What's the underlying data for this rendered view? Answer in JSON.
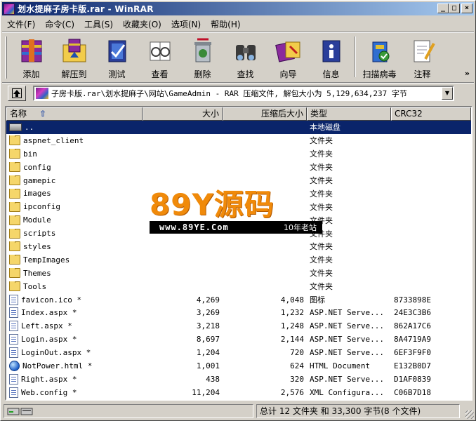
{
  "window": {
    "title": "划水提麻子房卡版.rar - WinRAR",
    "buttons": {
      "minimize": "_",
      "maximize": "□",
      "close": "×"
    }
  },
  "menu": [
    "文件(F)",
    "命令(C)",
    "工具(S)",
    "收藏夹(O)",
    "选项(N)",
    "帮助(H)"
  ],
  "toolbar": {
    "items": [
      {
        "label": "添加",
        "icon": "add-archive-icon"
      },
      {
        "label": "解压到",
        "icon": "extract-to-icon"
      },
      {
        "label": "测试",
        "icon": "test-icon"
      },
      {
        "label": "查看",
        "icon": "view-icon"
      },
      {
        "label": "删除",
        "icon": "delete-icon"
      },
      {
        "label": "查找",
        "icon": "find-icon"
      },
      {
        "label": "向导",
        "icon": "wizard-icon"
      },
      {
        "label": "信息",
        "icon": "info-icon"
      },
      {
        "label": "扫描病毒",
        "icon": "virus-scan-icon"
      },
      {
        "label": "注释",
        "icon": "comment-icon"
      }
    ],
    "more": "»"
  },
  "address": {
    "path": "子房卡版.rar\\划水提麻子\\网站\\GameAdmin - RAR 压缩文件, 解包大小为 5,129,634,237 字节"
  },
  "list": {
    "columns": {
      "name": "名称",
      "size": "大小",
      "packed": "压缩后大小",
      "type": "类型",
      "crc": "CRC32"
    },
    "rows": [
      {
        "name": "..",
        "size": "",
        "packed": "",
        "type": "本地磁盘",
        "crc": "",
        "kind": "drive",
        "selected": true
      },
      {
        "name": "aspnet_client",
        "size": "",
        "packed": "",
        "type": "文件夹",
        "crc": "",
        "kind": "folder"
      },
      {
        "name": "bin",
        "size": "",
        "packed": "",
        "type": "文件夹",
        "crc": "",
        "kind": "folder"
      },
      {
        "name": "config",
        "size": "",
        "packed": "",
        "type": "文件夹",
        "crc": "",
        "kind": "folder"
      },
      {
        "name": "gamepic",
        "size": "",
        "packed": "",
        "type": "文件夹",
        "crc": "",
        "kind": "folder"
      },
      {
        "name": "images",
        "size": "",
        "packed": "",
        "type": "文件夹",
        "crc": "",
        "kind": "folder"
      },
      {
        "name": "ipconfig",
        "size": "",
        "packed": "",
        "type": "文件夹",
        "crc": "",
        "kind": "folder"
      },
      {
        "name": "Module",
        "size": "",
        "packed": "",
        "type": "文件夹",
        "crc": "",
        "kind": "folder"
      },
      {
        "name": "scripts",
        "size": "",
        "packed": "",
        "type": "文件夹",
        "crc": "",
        "kind": "folder"
      },
      {
        "name": "styles",
        "size": "",
        "packed": "",
        "type": "文件夹",
        "crc": "",
        "kind": "folder"
      },
      {
        "name": "TempImages",
        "size": "",
        "packed": "",
        "type": "文件夹",
        "crc": "",
        "kind": "folder"
      },
      {
        "name": "Themes",
        "size": "",
        "packed": "",
        "type": "文件夹",
        "crc": "",
        "kind": "folder"
      },
      {
        "name": "Tools",
        "size": "",
        "packed": "",
        "type": "文件夹",
        "crc": "",
        "kind": "folder"
      },
      {
        "name": "favicon.ico *",
        "size": "4,269",
        "packed": "4,048",
        "type": "图标",
        "crc": "8733898E",
        "kind": "file"
      },
      {
        "name": "Index.aspx *",
        "size": "3,269",
        "packed": "1,232",
        "type": "ASP.NET Serve...",
        "crc": "24E3C3B6",
        "kind": "file"
      },
      {
        "name": "Left.aspx *",
        "size": "3,218",
        "packed": "1,248",
        "type": "ASP.NET Serve...",
        "crc": "862A17C6",
        "kind": "file"
      },
      {
        "name": "Login.aspx *",
        "size": "8,697",
        "packed": "2,144",
        "type": "ASP.NET Serve...",
        "crc": "8A4719A9",
        "kind": "file"
      },
      {
        "name": "LoginOut.aspx *",
        "size": "1,204",
        "packed": "720",
        "type": "ASP.NET Serve...",
        "crc": "6EF3F9F0",
        "kind": "file"
      },
      {
        "name": "NotPower.html *",
        "size": "1,001",
        "packed": "624",
        "type": "HTML Document",
        "crc": "E132B0D7",
        "kind": "web"
      },
      {
        "name": "Right.aspx *",
        "size": "438",
        "packed": "320",
        "type": "ASP.NET Serve...",
        "crc": "D1AF0839",
        "kind": "file"
      },
      {
        "name": "Web.config *",
        "size": "11,204",
        "packed": "2,576",
        "type": "XML Configura...",
        "crc": "C06B7D18",
        "kind": "file"
      }
    ]
  },
  "watermark": {
    "big": "89Y源码",
    "url": "www.89YE.Com",
    "slogan": "10年老站"
  },
  "status": {
    "summary": "总计 12 文件夹 和 33,300 字节(8 个文件)"
  }
}
